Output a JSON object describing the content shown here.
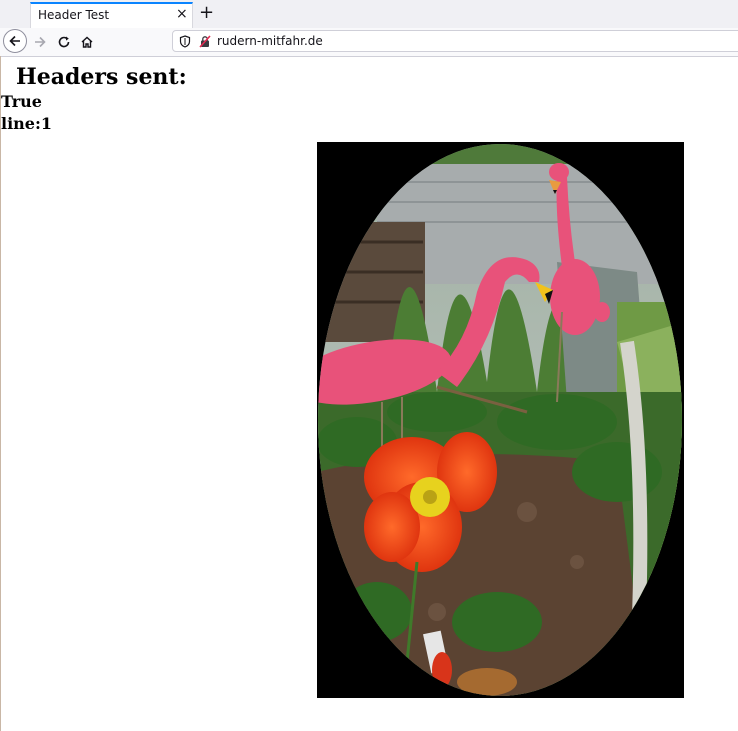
{
  "browser": {
    "tab_title": "Header Test",
    "tab_close": "×",
    "new_tab": "+",
    "url": "rudern-mitfahr.de"
  },
  "page": {
    "heading": "Headers sent:",
    "value": "True",
    "line": "line:1"
  },
  "image": {
    "description_icon": "flamingo-garden-photo",
    "colors": {
      "background": "#000000",
      "sky": "#b9c2c8",
      "grass": "#3f7a2a",
      "flamingo": "#e8527a",
      "poppy": "#f2360d",
      "soil": "#5b4332"
    }
  }
}
